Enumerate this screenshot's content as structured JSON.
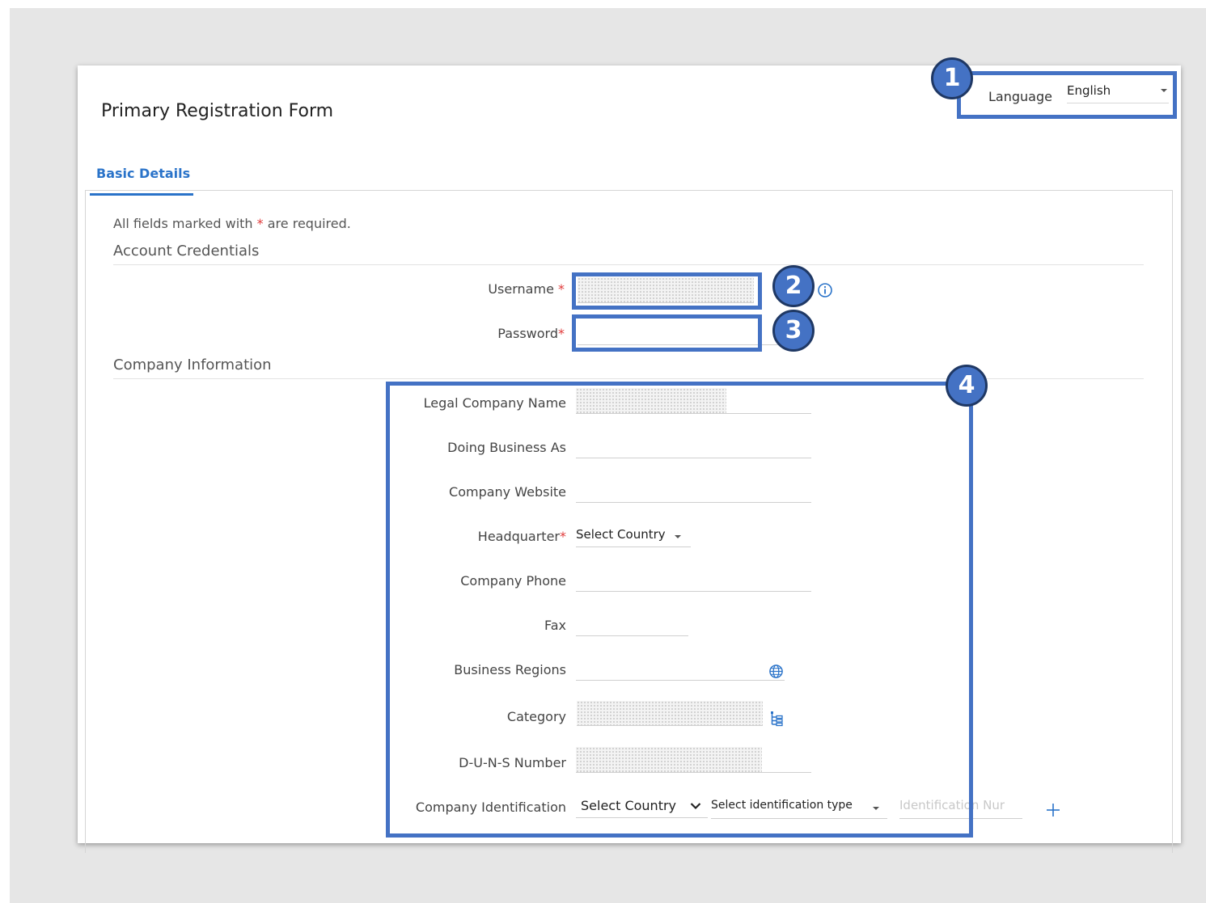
{
  "form": {
    "title": "Primary Registration Form",
    "language_label": "Language",
    "language_value": "English",
    "tab_label": "Basic Details",
    "required_note_before": "All fields marked with",
    "required_note_star": "*",
    "required_note_after": "are required."
  },
  "account": {
    "section_title": "Account Credentials",
    "username_label": "Username",
    "password_label": "Password",
    "star": "*"
  },
  "company": {
    "section_title": "Company Information",
    "legal_name_label": "Legal Company Name",
    "dba_label": "Doing Business As",
    "website_label": "Company Website",
    "hq_label": "Headquarter",
    "hq_value": "Select Country",
    "phone_label": "Company Phone",
    "fax_label": "Fax",
    "regions_label": "Business Regions",
    "category_label": "Category",
    "duns_label": "D-U-N-S Number",
    "identification_label": "Company Identification",
    "id_country_value": "Select Country",
    "id_type_value": "Select identification type",
    "id_number_placeholder": "Identification Nur"
  },
  "callouts": [
    "1",
    "2",
    "3",
    "4"
  ],
  "colors": {
    "callout": "#4472c4",
    "link": "#2a73c9",
    "required": "#e03a3a"
  },
  "icons": [
    "dropdown-caret-icon",
    "info-icon",
    "globe-icon",
    "tree-icon",
    "chevron-down-icon",
    "plus-icon"
  ]
}
